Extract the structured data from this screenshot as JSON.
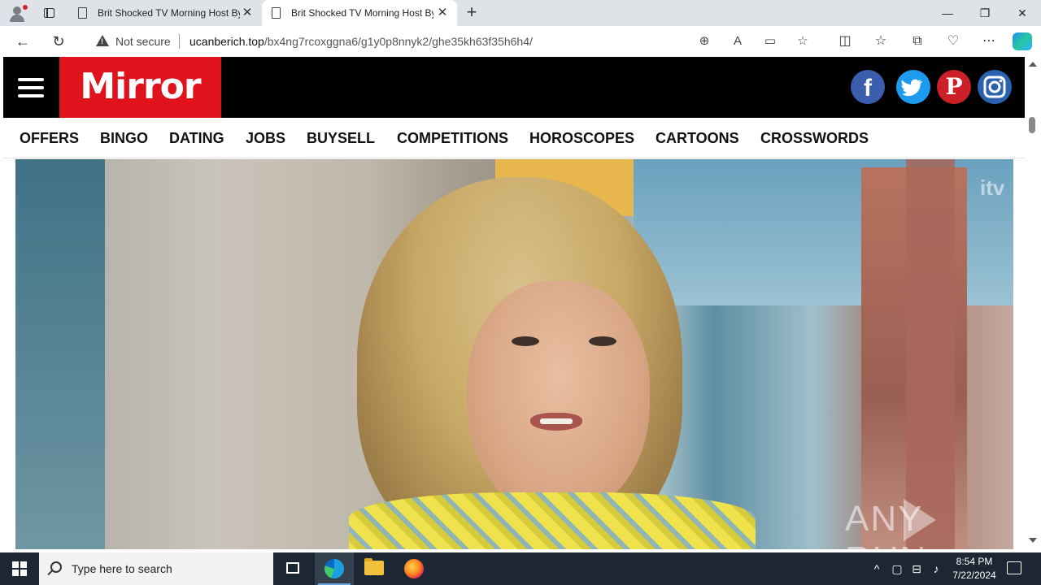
{
  "browser": {
    "tabs": [
      {
        "title": "Brit Shocked TV Morning Host By"
      },
      {
        "title": "Brit Shocked TV Morning Host By"
      }
    ],
    "address": {
      "security_label": "Not secure",
      "url_domain": "ucanberich.top",
      "url_path": "/bx4ng7rcoxggna6/g1y0p8nnyk2/ghe35kh63f35h6h4/"
    }
  },
  "site": {
    "logo": "Mirror",
    "social": {
      "facebook": "f",
      "pinterest": "P"
    },
    "nav": [
      "OFFERS",
      "BINGO",
      "DATING",
      "JOBS",
      "BUYSELL",
      "COMPETITIONS",
      "HOROSCOPES",
      "CARTOONS",
      "CROSSWORDS"
    ],
    "hero": {
      "channel_mark": "itv",
      "watermark": "ANY RUN"
    }
  },
  "taskbar": {
    "search_placeholder": "Type here to search",
    "time": "8:54 PM",
    "date": "7/22/2024"
  },
  "colors": {
    "mirror_red": "#e0121b",
    "header_black": "#000000",
    "taskbar": "#1c2733"
  }
}
